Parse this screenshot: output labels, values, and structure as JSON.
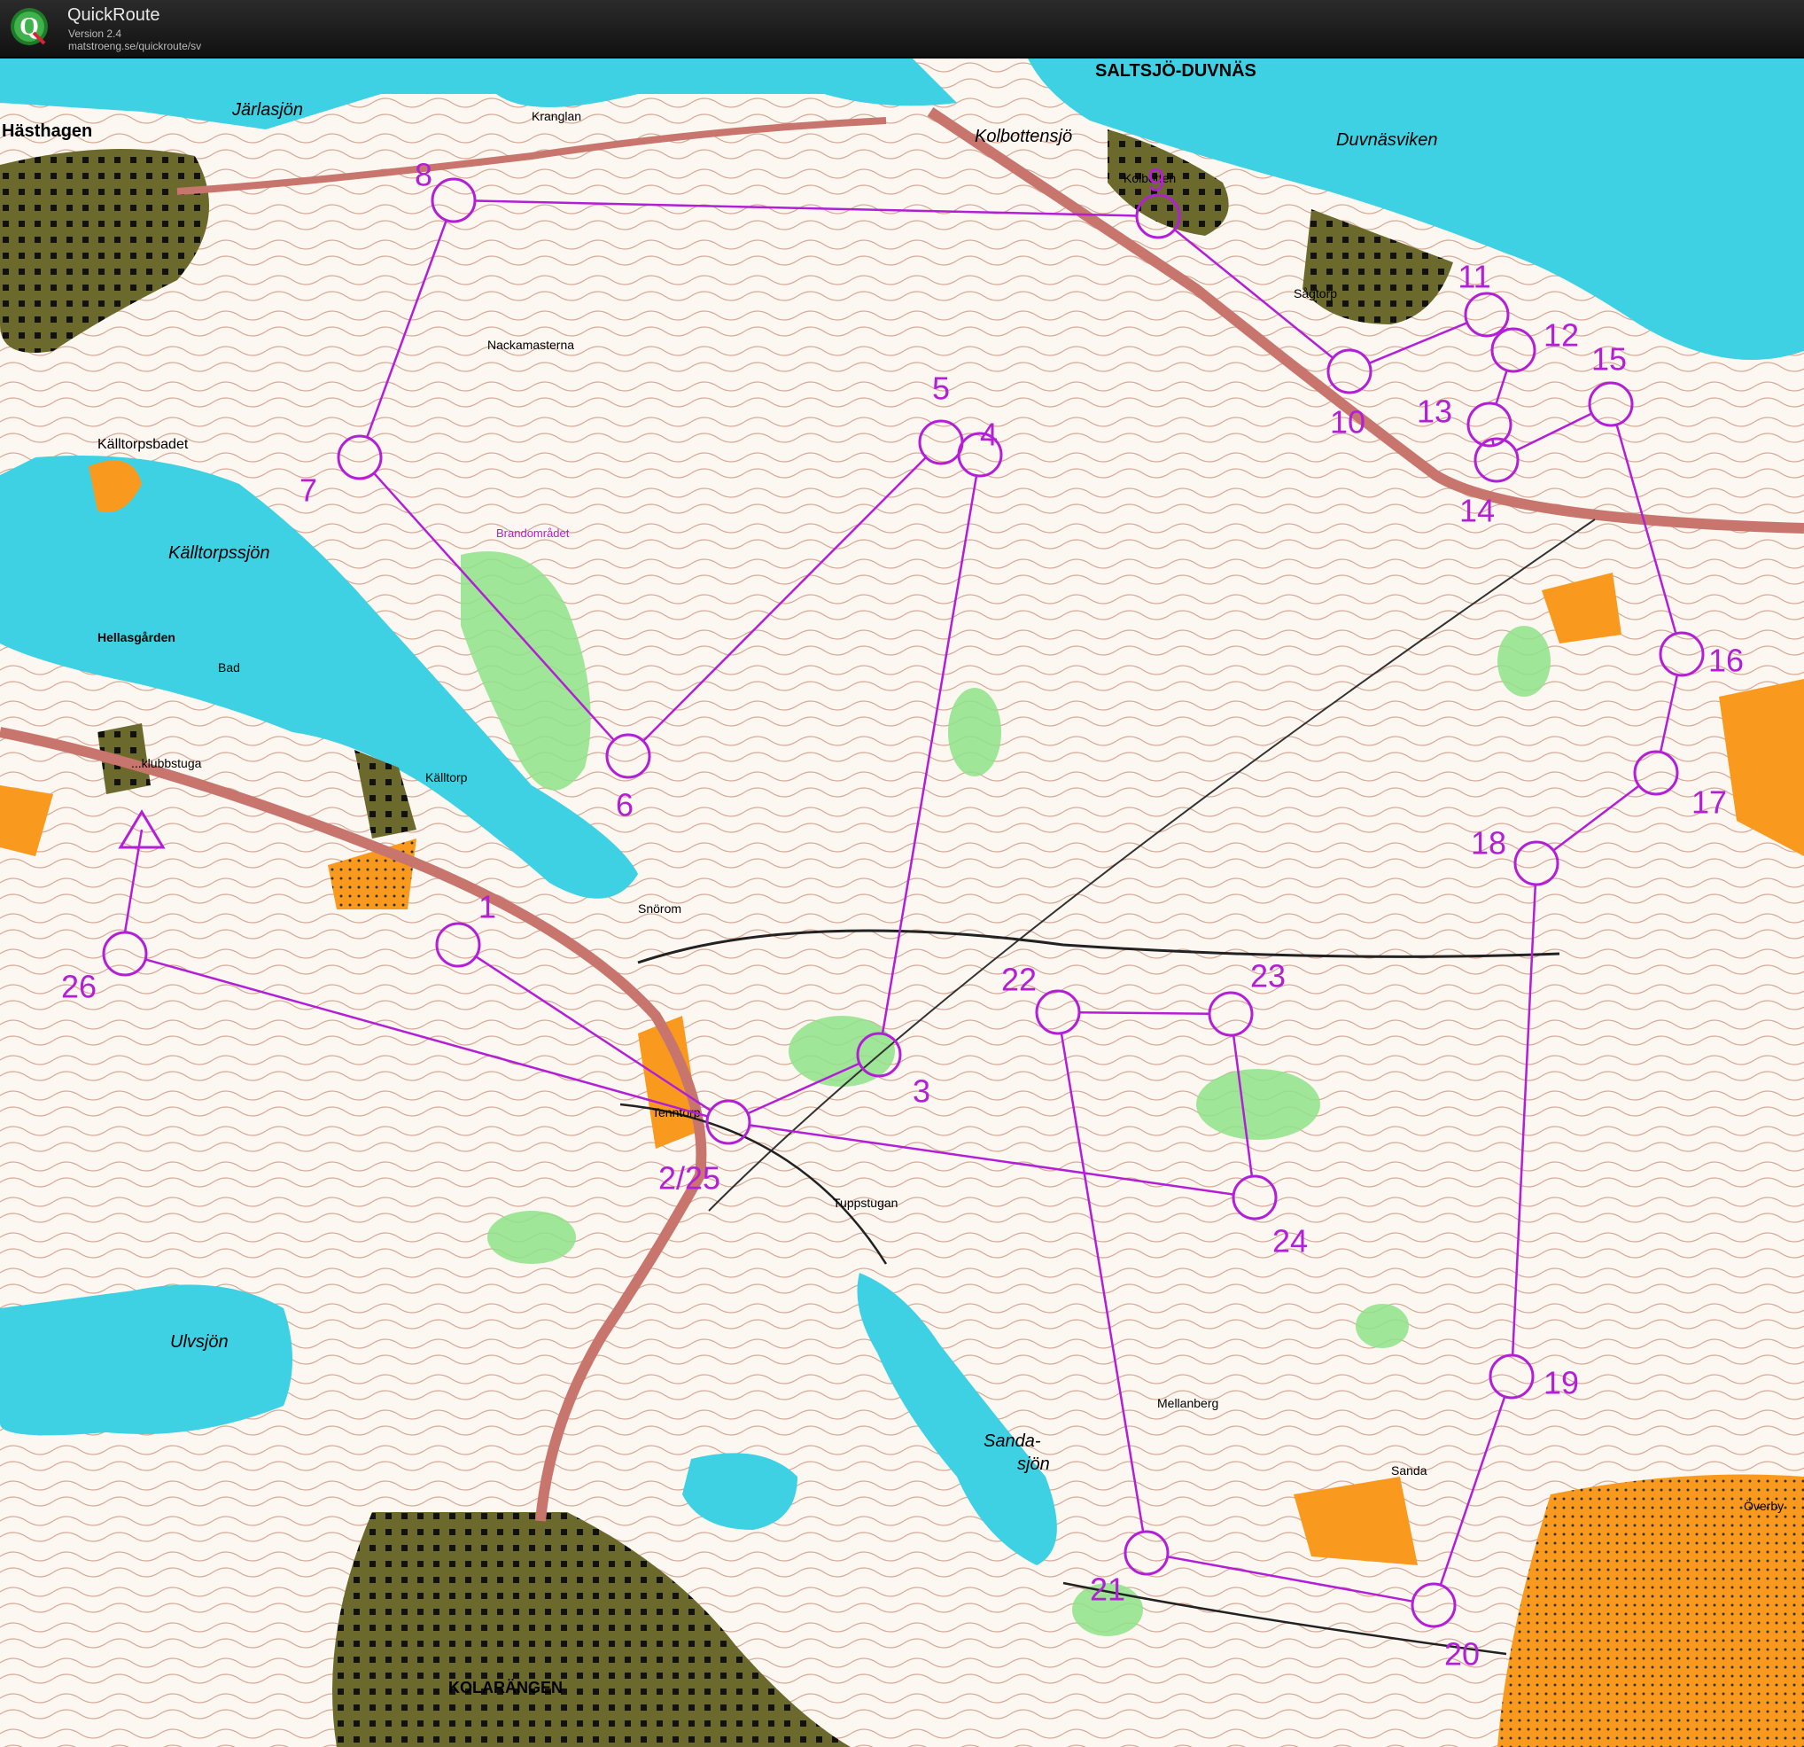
{
  "app": {
    "title": "QuickRoute",
    "version": "Version 2.4",
    "url": "matstroeng.se/quickroute/sv",
    "icon": "quickroute-logo-icon"
  },
  "colors": {
    "water": "#3ed1e4",
    "forest": "#ffffff",
    "green": "#8fe38a",
    "settlement": "#6b6a2c",
    "open_land": "#f99a1f",
    "contour": "#a0522d",
    "course": "#b21fd6",
    "road": "#c8766d"
  },
  "places": [
    {
      "id": "hasthagen",
      "label": "Hästhagen"
    },
    {
      "id": "jarlasjon",
      "label": "Järlasjön"
    },
    {
      "id": "kranglan",
      "label": "Kranglan"
    },
    {
      "id": "saltsjo-duvnas",
      "label": "SALTSJÖ-DUVNÄS"
    },
    {
      "id": "kolbottensjo",
      "label": "Kolbottensjö"
    },
    {
      "id": "kolbotten",
      "label": "Kolbotten"
    },
    {
      "id": "duvnasviken",
      "label": "Duvnäsviken"
    },
    {
      "id": "sagtorp",
      "label": "Sågtorp"
    },
    {
      "id": "nackamasterna",
      "label": "Nackamasterna"
    },
    {
      "id": "kalltorpsbadet",
      "label": "Källtorpsbadet"
    },
    {
      "id": "kalltorpssjon",
      "label": "Källtorpssjön"
    },
    {
      "id": "brandomradet",
      "label": "Brandområdet"
    },
    {
      "id": "hellasgarden",
      "label": "Hellasgården"
    },
    {
      "id": "bad",
      "label": "Bad"
    },
    {
      "id": "klubbstuga",
      "label": "...klubbstuga"
    },
    {
      "id": "kalltorp",
      "label": "Källtorp"
    },
    {
      "id": "snorom",
      "label": "Snörom"
    },
    {
      "id": "tenntorp",
      "label": "Tenntorp"
    },
    {
      "id": "tuppstugan",
      "label": "Tuppstugan"
    },
    {
      "id": "ulvsjon",
      "label": "Ulvsjön"
    },
    {
      "id": "sandasjon-1",
      "label": "Sanda-"
    },
    {
      "id": "sandasjon-2",
      "label": "sjön"
    },
    {
      "id": "mellanberg",
      "label": "Mellanberg"
    },
    {
      "id": "sanda",
      "label": "Sanda"
    },
    {
      "id": "overby",
      "label": "Överby"
    },
    {
      "id": "kolarangen",
      "label": "KOLARÄNGEN"
    }
  ],
  "course": {
    "start_finish_label": "",
    "controls": [
      {
        "n": "1",
        "label": "1"
      },
      {
        "n": "2/25",
        "label": "2/25"
      },
      {
        "n": "3",
        "label": "3"
      },
      {
        "n": "4",
        "label": "4"
      },
      {
        "n": "5",
        "label": "5"
      },
      {
        "n": "6",
        "label": "6"
      },
      {
        "n": "7",
        "label": "7"
      },
      {
        "n": "8",
        "label": "8"
      },
      {
        "n": "9",
        "label": "9"
      },
      {
        "n": "10",
        "label": "10"
      },
      {
        "n": "11",
        "label": "11"
      },
      {
        "n": "12",
        "label": "12"
      },
      {
        "n": "13",
        "label": "13"
      },
      {
        "n": "14",
        "label": "14"
      },
      {
        "n": "15",
        "label": "15"
      },
      {
        "n": "16",
        "label": "16"
      },
      {
        "n": "17",
        "label": "17"
      },
      {
        "n": "18",
        "label": "18"
      },
      {
        "n": "19",
        "label": "19"
      },
      {
        "n": "20",
        "label": "20"
      },
      {
        "n": "21",
        "label": "21"
      },
      {
        "n": "22",
        "label": "22"
      },
      {
        "n": "23",
        "label": "23"
      },
      {
        "n": "24",
        "label": "24"
      },
      {
        "n": "26",
        "label": "26"
      }
    ]
  }
}
